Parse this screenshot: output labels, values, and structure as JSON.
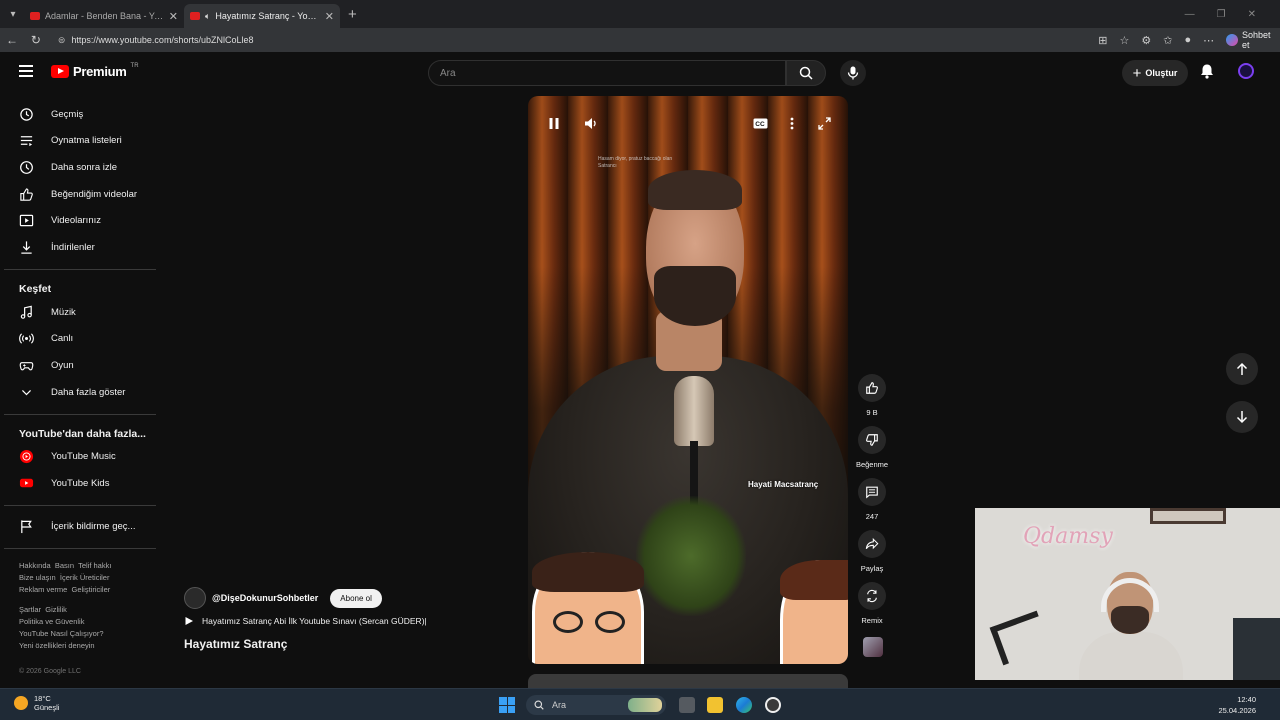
{
  "browser": {
    "tabs": [
      {
        "title": "Adamlar - Benden Bana - YouTube",
        "active": false
      },
      {
        "title": "Hayatımız Satranç - YouTube",
        "active": true
      }
    ],
    "url": "https://www.youtube.com/shorts/ubZNlCoLle8",
    "copilot_label": "Sohbet et"
  },
  "header": {
    "logo_text": "Premium",
    "logo_country": "TR",
    "search_placeholder": "Ara",
    "create_label": "Oluştur"
  },
  "sidebar": {
    "items_you": [
      {
        "label": "Geçmiş",
        "icon": "history-icon"
      },
      {
        "label": "Oynatma listeleri",
        "icon": "playlist-icon"
      },
      {
        "label": "Daha sonra izle",
        "icon": "clock-icon"
      },
      {
        "label": "Beğendiğim videolar",
        "icon": "thumbs-up-icon"
      },
      {
        "label": "Videolarınız",
        "icon": "video-icon"
      },
      {
        "label": "İndirilenler",
        "icon": "download-icon"
      }
    ],
    "explore_title": "Keşfet",
    "items_explore": [
      {
        "label": "Müzik",
        "icon": "music-icon"
      },
      {
        "label": "Canlı",
        "icon": "live-icon"
      },
      {
        "label": "Oyun",
        "icon": "gamepad-icon"
      },
      {
        "label": "Daha fazla göster",
        "icon": "chevron-down-icon"
      }
    ],
    "more_title": "YouTube'dan daha fazla...",
    "items_more": [
      {
        "label": "YouTube Music",
        "icon": "youtube-music-icon"
      },
      {
        "label": "YouTube Kids",
        "icon": "youtube-kids-icon"
      }
    ],
    "report_label": "İçerik bildirme geç...",
    "footer_1": [
      "Hakkında",
      "Basın",
      "Telif hakkı",
      "Bize ulaşın",
      "İçerik Üreticiler",
      "Reklam verme",
      "Geliştiriciler"
    ],
    "footer_2": [
      "Şartlar",
      "Gizlilik",
      "Politika ve Güvenlik",
      "YouTube Nasıl Çalışıyor?",
      "Yeni özellikleri deneyin"
    ],
    "copyright": "© 2026 Google LLC"
  },
  "video": {
    "overlay_text": "Hayati Macsatranç",
    "caption_text": "Hasam diyor, pratuz baccağı olan Satrancı",
    "channel": "@DişeDokunurSohbetler",
    "subscribe_label": "Abone ol",
    "song": "Hayatımız Satranç Abi İlk Youtube Sınavı (Sercan GÜDER)|",
    "title": "Hayatımız Satranç"
  },
  "actions": {
    "like_count": "9 B",
    "dislike_label": "Beğenme",
    "comment_count": "247",
    "share_label": "Paylaş",
    "remix_label": "Remix"
  },
  "webcam": {
    "sign_text": "Qdamsy"
  },
  "taskbar": {
    "temperature": "18°C",
    "weather": "Güneşli",
    "search_label": "Ara",
    "time": "12:40",
    "date": "25.04.2026"
  }
}
